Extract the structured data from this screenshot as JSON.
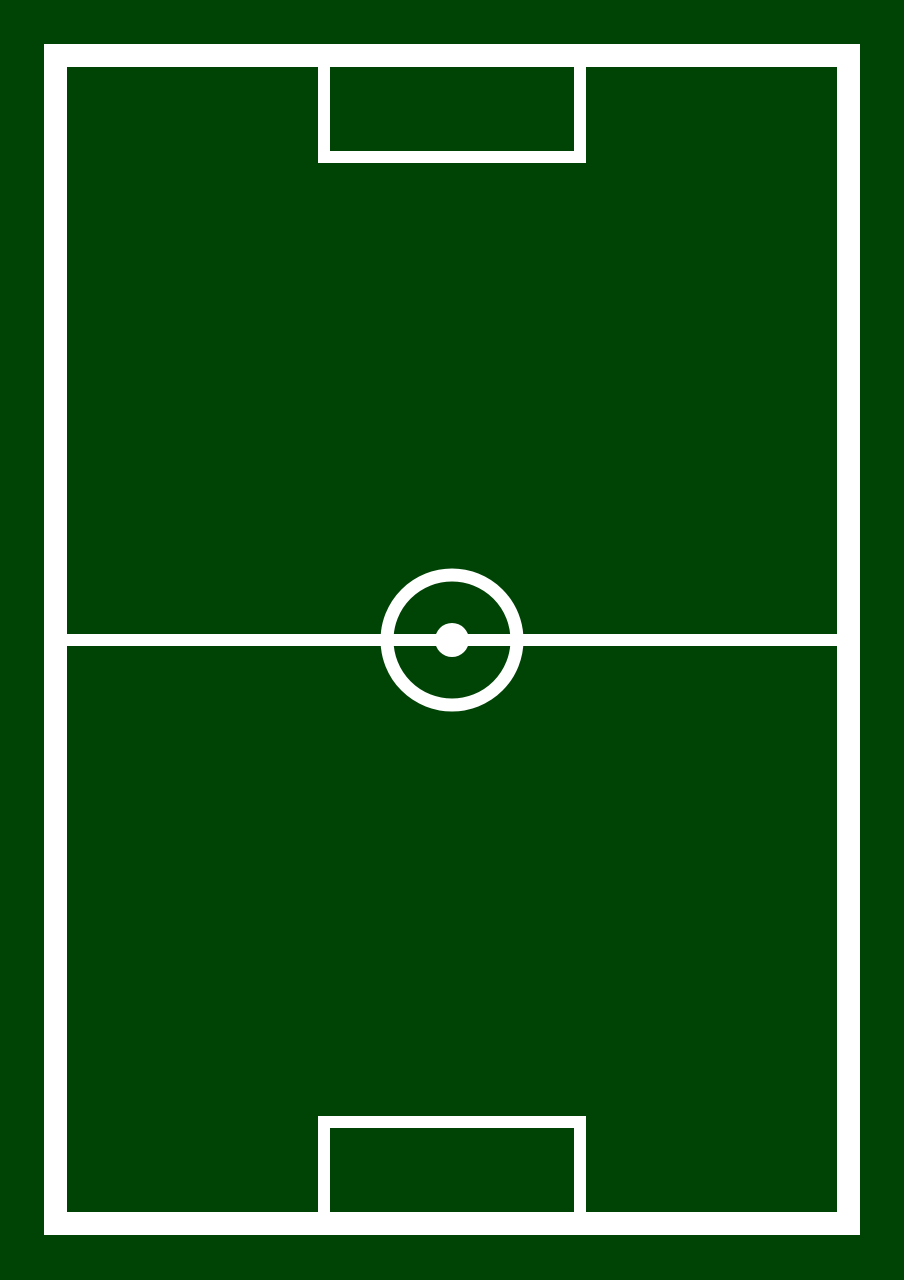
{
  "colors": {
    "grass": "#004405",
    "lines": "#ffffff"
  },
  "field": {
    "type": "football-pitch",
    "orientation": "portrait",
    "markings": [
      "boundary",
      "halfway-line",
      "center-circle",
      "center-spot",
      "top-goal-area",
      "bottom-goal-area"
    ]
  }
}
